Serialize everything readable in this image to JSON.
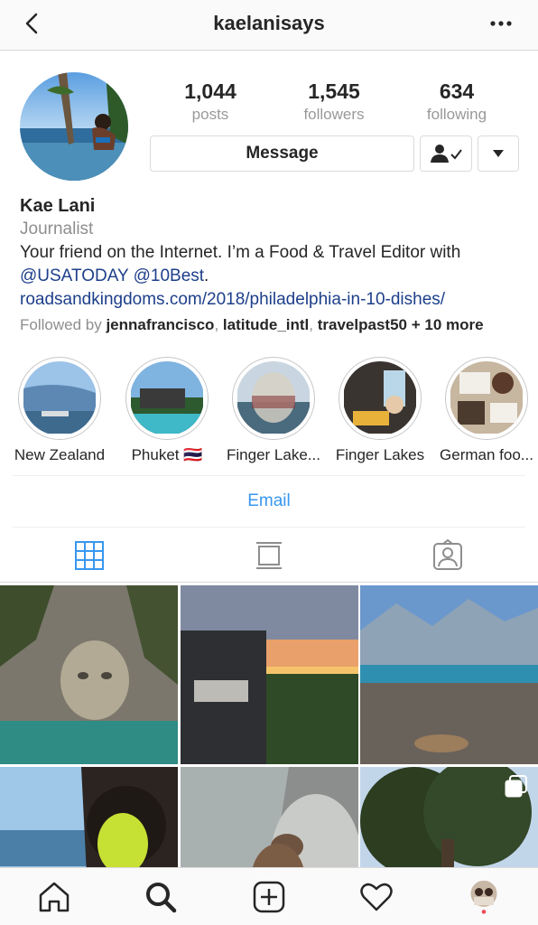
{
  "header": {
    "username": "kaelanisays"
  },
  "stats": [
    {
      "value": "1,044",
      "label": "posts"
    },
    {
      "value": "1,545",
      "label": "followers"
    },
    {
      "value": "634",
      "label": "following"
    }
  ],
  "actions": {
    "message_label": "Message"
  },
  "bio": {
    "name": "Kae Lani",
    "category": "Journalist",
    "line1": "Your friend on the Internet. I’m a Food & Travel Editor with",
    "mention1": "@USATODAY",
    "mention2": "@10Best",
    "period": ".",
    "url": "roadsandkingdoms.com/2018/philadelphia-in-10-dishes/",
    "followed_by_prefix": "Followed by ",
    "followed_by_users": [
      "jennafrancisco",
      "latitude_intl",
      "travelpast50"
    ],
    "followed_by_more": "+ 10 more"
  },
  "highlights": [
    {
      "label": "New Zealand"
    },
    {
      "label": "Phuket 🇹🇭"
    },
    {
      "label": "Finger Lake..."
    },
    {
      "label": "Finger Lakes"
    },
    {
      "label": "German foo..."
    }
  ],
  "email_label": "Email",
  "tabs": [
    "grid-icon",
    "feed-icon",
    "tagged-icon"
  ],
  "colors": {
    "link": "#1d3f8a",
    "accent": "#3897f0",
    "muted": "#8e8e8e",
    "border": "#dbdbdb"
  },
  "bottom_nav": [
    "home-icon",
    "search-icon",
    "add-icon",
    "heart-icon",
    "profile-avatar"
  ]
}
